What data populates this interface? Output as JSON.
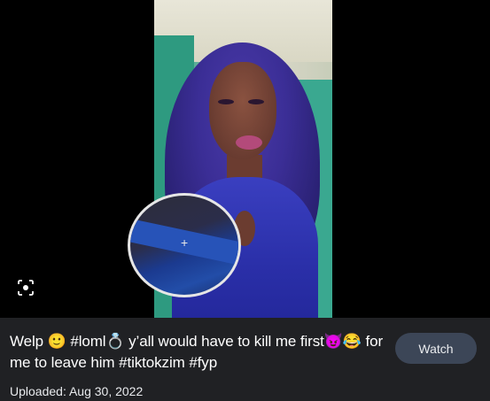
{
  "caption": {
    "text": "Welp 🙂 #loml💍 y’all would have to kill me first😈😂 for me to leave him #tiktokzim #fyp"
  },
  "uploaded": "Uploaded: Aug 30, 2022",
  "watch_label": "Watch",
  "icons": {
    "lens": "lens-search-icon",
    "crosshair": "crosshair-icon"
  }
}
